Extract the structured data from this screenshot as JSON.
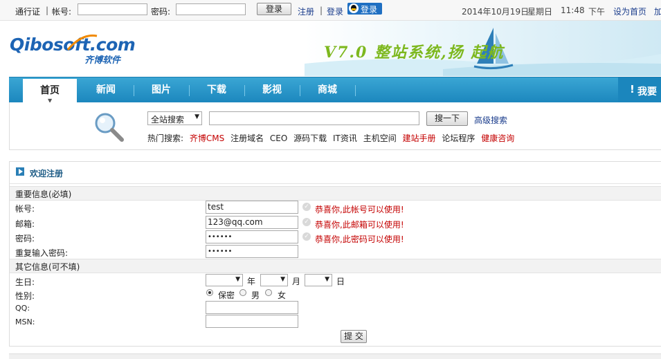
{
  "topbar": {
    "passport": "通行证",
    "account_label": "帐号:",
    "password_label": "密码:",
    "login_button": "登录",
    "register_link": "注册",
    "login_link": "登录",
    "qq_login": "登录",
    "date": "2014年10月19日",
    "weekday": "星期日",
    "time": "11:48",
    "ampm": "下午",
    "set_home": "设为首页",
    "favorite": "加"
  },
  "header": {
    "logo": "Qibosoft.com",
    "logo_sub": "齐博软件",
    "slogan": "V7.0 整站系统,扬  起航"
  },
  "nav": {
    "items": [
      "首页",
      "新闻",
      "图片",
      "下载",
      "影视",
      "商城"
    ],
    "right_link": "我要"
  },
  "search": {
    "scope": "全站搜索",
    "query": "",
    "button": "搜一下",
    "advanced": "高级搜索",
    "hot_label": "热门搜索:",
    "hot": [
      {
        "text": "齐博CMS",
        "red": true
      },
      {
        "text": "注册域名",
        "red": false
      },
      {
        "text": "CEO",
        "red": false
      },
      {
        "text": "源码下载",
        "red": false
      },
      {
        "text": "IT资讯",
        "red": false
      },
      {
        "text": "主机空间",
        "red": false
      },
      {
        "text": "建站手册",
        "red": true
      },
      {
        "text": "论坛程序",
        "red": false
      },
      {
        "text": "健康咨询",
        "red": true
      }
    ]
  },
  "form": {
    "title": "欢迎注册",
    "section_required": "重要信息(必填)",
    "section_optional": "其它信息(可不填)",
    "account_label": "帐号:",
    "account_value": "test",
    "account_msg": "恭喜你,此帐号可以使用!",
    "email_label": "邮箱:",
    "email_value": "123@qq.com",
    "email_msg": "恭喜你,此邮箱可以使用!",
    "password_label": "密码:",
    "password_value": "••••••",
    "password_msg": "恭喜你,此密码可以使用!",
    "repeat_label": "重复输入密码:",
    "repeat_value": "••••••",
    "birthday_label": "生日:",
    "year": "年",
    "month": "月",
    "day": "日",
    "gender_label": "性别:",
    "gender_options": [
      "保密",
      "男",
      "女"
    ],
    "gender_selected": "保密",
    "qq_label": "QQ:",
    "msn_label": "MSN:",
    "submit": "提 交"
  }
}
